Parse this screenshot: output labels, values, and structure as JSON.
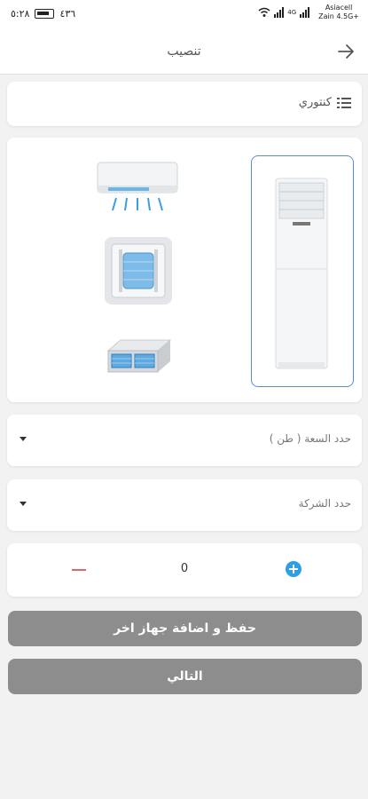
{
  "status_bar": {
    "time": "٥:٢٨",
    "battery_level": "٤٣٦",
    "signal_label": "4G",
    "carrier_top": "Asiacell",
    "carrier_bottom": "Zain 4.5G+"
  },
  "header": {
    "title": "تنصيب",
    "back_icon": "arrow-right-icon"
  },
  "category": {
    "icon": "menu-list-icon",
    "label": "كنتوري"
  },
  "units": [
    {
      "name": "floor-standing-ac",
      "selected": true
    },
    {
      "name": "split-wall-ac",
      "selected": false
    },
    {
      "name": "cassette-ac",
      "selected": false
    },
    {
      "name": "ducted-ac",
      "selected": false
    }
  ],
  "capacity_select": {
    "placeholder": "حدد السعة ( طن )"
  },
  "company_select": {
    "placeholder": "حدد الشركة"
  },
  "quantity": {
    "value": "0"
  },
  "buttons": {
    "save_add_label": "حفظ و اضافة جهاز اخر",
    "next_label": "التالي"
  },
  "colors": {
    "accent": "#5b8bd6",
    "plus": "#2e9fe4",
    "minus": "#e0646e",
    "button_gray": "#8d8d8d"
  }
}
